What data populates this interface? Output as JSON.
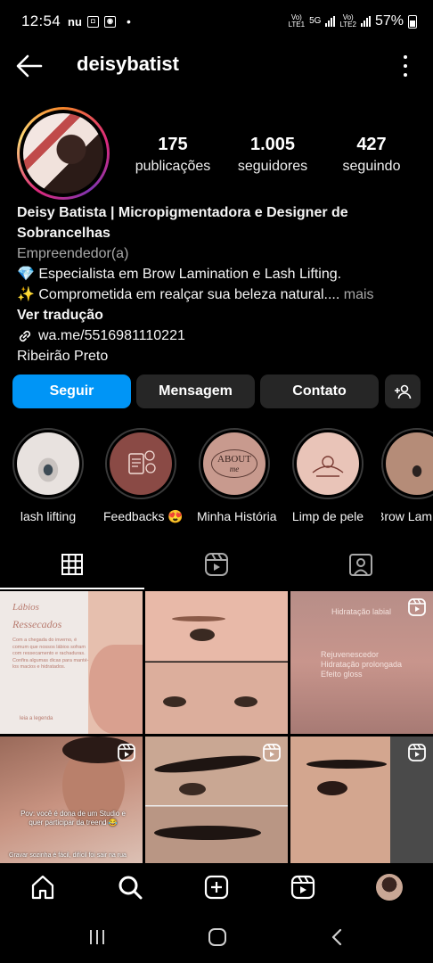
{
  "status_bar": {
    "time": "12:54",
    "notif_icon_1": "nu",
    "sim1_label": "LTE1",
    "sim2_label": "LTE2",
    "network": "5G",
    "battery": "57%"
  },
  "header": {
    "username": "deisybatist",
    "back_icon": "arrow-left-icon",
    "menu_icon": "more-vertical-icon"
  },
  "profile": {
    "stats": [
      {
        "value": "175",
        "label": "publicações"
      },
      {
        "value": "1.005",
        "label": "seguidores"
      },
      {
        "value": "427",
        "label": "seguindo"
      }
    ],
    "name_line1": "Deisy Batista | Micropigmentadora e Designer de",
    "name_line2": "Sobrancelhas",
    "category": "Empreendedor(a)",
    "bio_line1": "💎 Especialista em Brow Lamination e Lash Lifting.",
    "bio_line2": "✨ Comprometida em realçar sua beleza natural....",
    "bio_more": " mais",
    "translate": "Ver tradução",
    "link": "wa.me/5516981110221",
    "location": "Ribeirão Preto"
  },
  "buttons": {
    "follow": "Seguir",
    "message": "Mensagem",
    "contact": "Contato"
  },
  "highlights": [
    {
      "label": "lash lifting"
    },
    {
      "label": "Feedbacks 😍"
    },
    {
      "label": "Minha História",
      "inner_text": "ABOUT",
      "inner_sub": "me"
    },
    {
      "label": "Limp de pele"
    },
    {
      "label": "Brow Lam"
    }
  ],
  "posts": [
    {
      "text_title": "Lábios",
      "text_sub": "Ressecados",
      "text_body": "Com a chegada do inverno, é comum que nossos lábios sofram com ressecamento e rachaduras. Confira algumas dicas para manté-los macios e hidratados.",
      "text_footer": "leia a legenda"
    },
    {},
    {
      "text_top": "Hidratação labial",
      "text_body": "Rejuvenescedor\nHidratação prolongada\nEfeito gloss"
    },
    {
      "caption": "Pov: você é dona de um Studio e quer participar da treend 😂",
      "caption2": "Gravar sozinha é fácil, difícil foi sair na rua"
    },
    {},
    {}
  ],
  "colors": {
    "follow_blue": "#0095f6",
    "button_gray": "#262626",
    "background": "#000000"
  }
}
